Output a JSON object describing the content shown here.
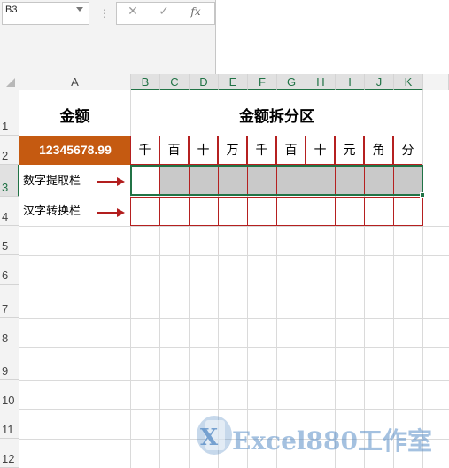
{
  "toolbar": {
    "name_box": "B3",
    "grip": "⋮",
    "cancel_symbol": "✕",
    "enter_symbol": "✓",
    "fx_symbol": "fx",
    "formula_value": ""
  },
  "columns": [
    "A",
    "B",
    "C",
    "D",
    "E",
    "F",
    "G",
    "H",
    "I",
    "J",
    "K"
  ],
  "rows": [
    "1",
    "2",
    "3",
    "4",
    "5",
    "6",
    "7",
    "8",
    "9",
    "10",
    "11",
    "12"
  ],
  "sheet": {
    "amount_title": "金额",
    "split_title": "金额拆分区",
    "amount_value": "12345678.99",
    "units": [
      "千",
      "百",
      "十",
      "万",
      "千",
      "百",
      "十",
      "元",
      "角",
      "分"
    ],
    "row3_label": "数字提取栏",
    "row4_label": "汉字转换栏"
  },
  "watermark": {
    "text": "Excel880工作室",
    "logo_letters": "X"
  },
  "colors": {
    "excel_green": "#217346",
    "amount_fill": "#c55a11",
    "border_red": "#b52020",
    "extract_gray": "#c9c9c9"
  }
}
